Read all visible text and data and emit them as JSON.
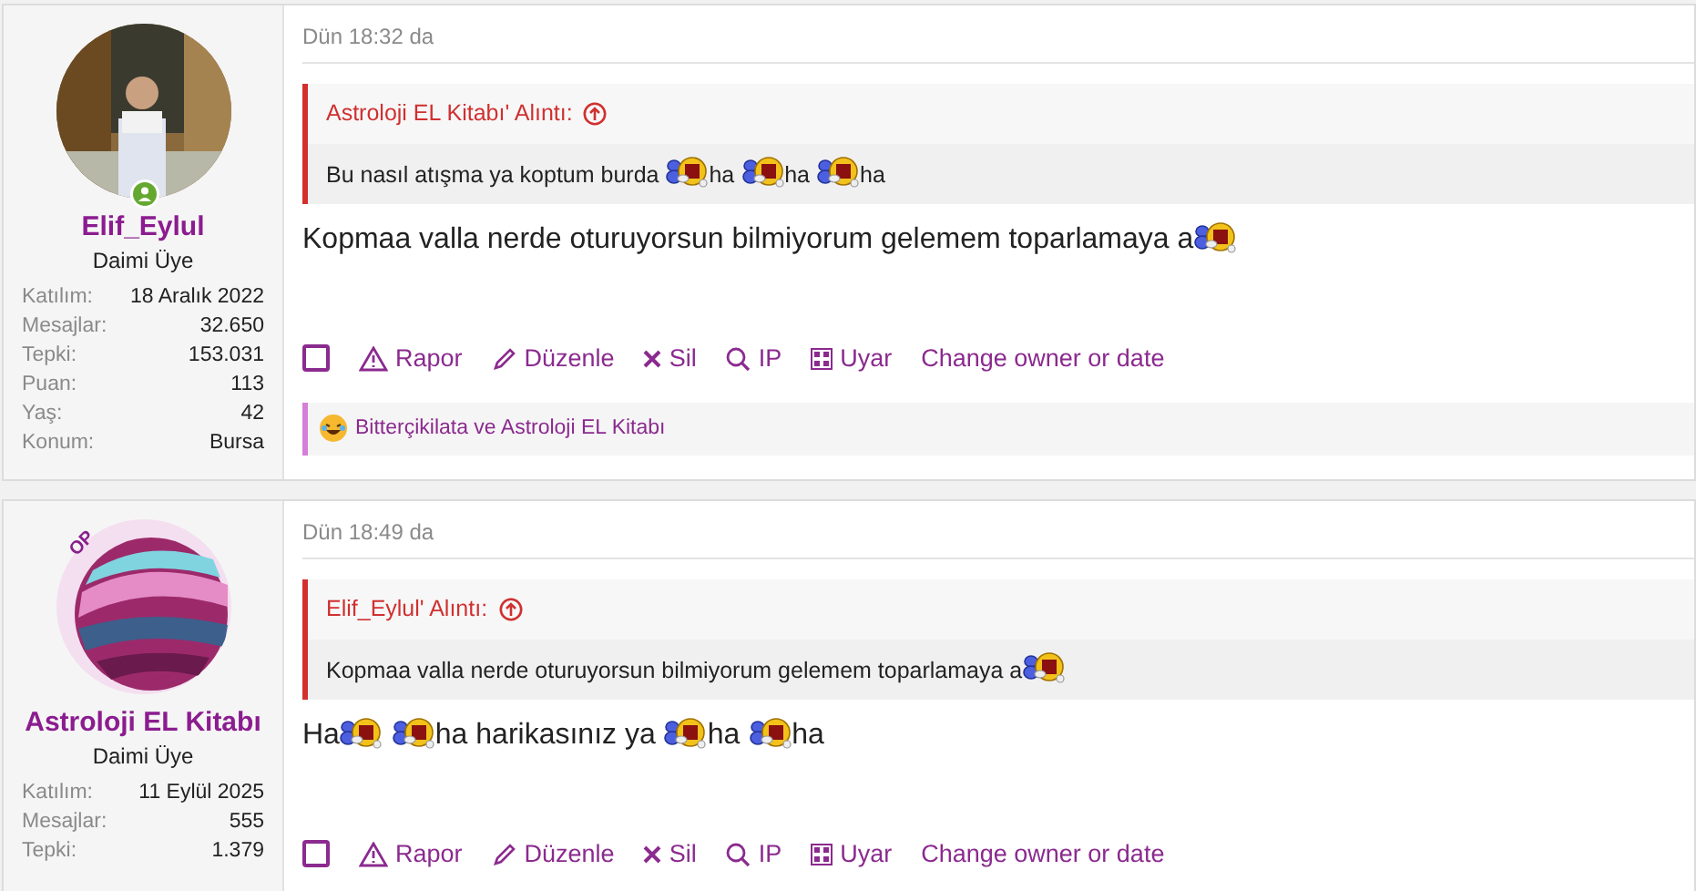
{
  "posts": [
    {
      "author": {
        "name": "Elif_Eylul",
        "title": "Daimi Üye",
        "online": true,
        "stats": [
          {
            "label": "Katılım:",
            "value": "18 Aralık 2022"
          },
          {
            "label": "Mesajlar:",
            "value": "32.650"
          },
          {
            "label": "Tepki:",
            "value": "153.031"
          },
          {
            "label": "Puan:",
            "value": "113"
          },
          {
            "label": "Yaş:",
            "value": "42"
          },
          {
            "label": "Konum:",
            "value": "Bursa"
          }
        ]
      },
      "date": "Dün 18:32 da",
      "quote": {
        "header": "Astroloji EL Kitabı' Alıntı:",
        "body": [
          {
            "kind": "text",
            "text": "Bu nasıl atışma ya koptum burda "
          },
          {
            "kind": "smiley"
          },
          {
            "kind": "text",
            "text": "ha "
          },
          {
            "kind": "smiley"
          },
          {
            "kind": "text",
            "text": "ha "
          },
          {
            "kind": "smiley"
          },
          {
            "kind": "text",
            "text": "ha"
          }
        ]
      },
      "body": [
        {
          "kind": "text",
          "text": "Kopmaa valla nerde oturuyorsun bilmiyorum gelemem toparlamaya a"
        },
        {
          "kind": "smiley"
        }
      ],
      "actions": [
        {
          "kind": "checkbox",
          "checked": false
        },
        {
          "kind": "report",
          "label": "Rapor"
        },
        {
          "kind": "edit",
          "label": "Düzenle"
        },
        {
          "kind": "delete",
          "label": "Sil"
        },
        {
          "kind": "ip",
          "label": "IP"
        },
        {
          "kind": "warn",
          "label": "Uyar"
        },
        {
          "kind": "owner",
          "label": "Change owner or date"
        }
      ],
      "reactions": "Bitterçikilata ve Astroloji EL Kitabı"
    },
    {
      "author": {
        "name": "Astroloji EL Kitabı",
        "title": "Daimi Üye",
        "badge": "OP",
        "stats": [
          {
            "label": "Katılım:",
            "value": "11 Eylül 2025"
          },
          {
            "label": "Mesajlar:",
            "value": "555"
          },
          {
            "label": "Tepki:",
            "value": "1.379"
          }
        ]
      },
      "date": "Dün 18:49 da",
      "quote": {
        "header": "Elif_Eylul' Alıntı:",
        "body": [
          {
            "kind": "text",
            "text": "Kopmaa valla nerde oturuyorsun bilmiyorum gelemem toparlamaya a"
          },
          {
            "kind": "smiley"
          }
        ]
      },
      "body": [
        {
          "kind": "text",
          "text": "Ha"
        },
        {
          "kind": "smiley"
        },
        {
          "kind": "space"
        },
        {
          "kind": "smiley"
        },
        {
          "kind": "text",
          "text": "ha harikasınız ya "
        },
        {
          "kind": "smiley"
        },
        {
          "kind": "text",
          "text": "ha "
        },
        {
          "kind": "smiley"
        },
        {
          "kind": "text",
          "text": "ha"
        }
      ],
      "actions": [
        {
          "kind": "checkbox",
          "checked": false
        },
        {
          "kind": "report",
          "label": "Rapor"
        },
        {
          "kind": "edit",
          "label": "Düzenle"
        },
        {
          "kind": "delete",
          "label": "Sil"
        },
        {
          "kind": "ip",
          "label": "IP"
        },
        {
          "kind": "warn",
          "label": "Uyar"
        },
        {
          "kind": "owner",
          "label": "Change owner or date"
        }
      ]
    }
  ]
}
